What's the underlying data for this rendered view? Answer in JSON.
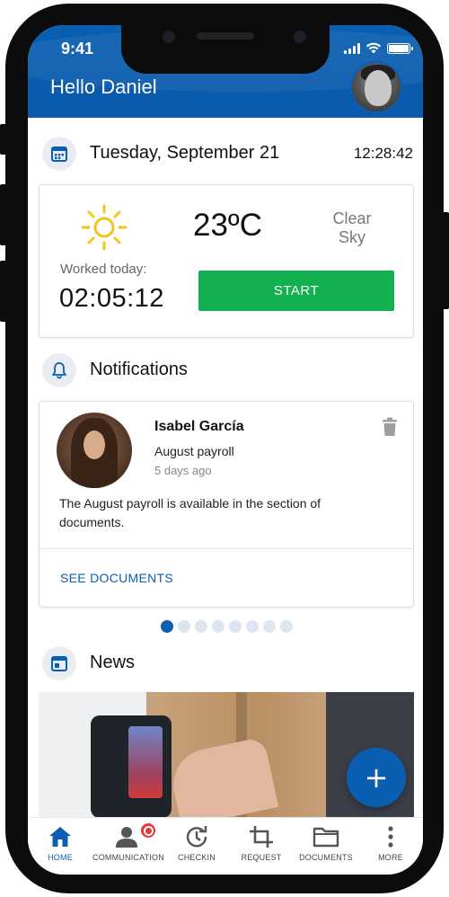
{
  "status_bar": {
    "time": "9:41"
  },
  "header": {
    "greeting": "Hello Daniel"
  },
  "today": {
    "date": "Tuesday, September 21",
    "clock": "12:28:42"
  },
  "weather": {
    "temperature": "23ºC",
    "condition_line1": "Clear",
    "condition_line2": "Sky",
    "worked_label": "Worked today:",
    "worked_value": "02:05:12",
    "start_label": "START"
  },
  "notifications": {
    "title": "Notifications",
    "item": {
      "sender": "Isabel García",
      "subject": "August payroll",
      "ago": "5 days ago",
      "body": "The August payroll is available in the section of documents.",
      "action": "SEE DOCUMENTS"
    },
    "pagination": {
      "count": 8,
      "active_index": 0
    }
  },
  "news": {
    "title": "News"
  },
  "fab_label": "+",
  "nav": {
    "items": [
      {
        "label": "HOME",
        "icon": "home-icon"
      },
      {
        "label": "COMMUNICATION",
        "icon": "communication-icon"
      },
      {
        "label": "CHECKIN",
        "icon": "checkin-icon"
      },
      {
        "label": "REQUEST",
        "icon": "crop-icon"
      },
      {
        "label": "DOCUMENTS",
        "icon": "folder-icon"
      },
      {
        "label": "MORE",
        "icon": "more-icon"
      }
    ]
  },
  "colors": {
    "primary": "#0a5fb2",
    "accent_green": "#12b04f",
    "badge_red": "#e53935",
    "sun_yellow": "#f6c21c"
  }
}
